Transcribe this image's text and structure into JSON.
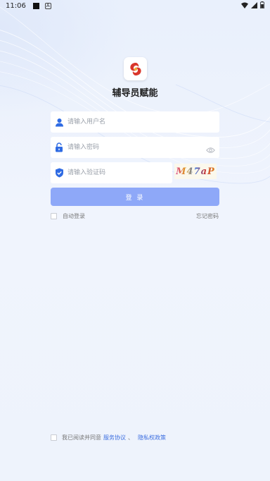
{
  "status_bar": {
    "time": "11:06",
    "notification_icon": "a-icon",
    "icons": [
      "wifi-icon",
      "signal-icon",
      "battery-icon"
    ]
  },
  "app": {
    "title": "辅导员赋能",
    "logo_icon": "red-emblem-logo"
  },
  "form": {
    "username_placeholder": "请输入用户名",
    "password_placeholder": "请输入密码",
    "captcha_placeholder": "请输入验证码",
    "captcha_text": "M47aP",
    "login_label": "登 录",
    "auto_login_label": "自动登录",
    "forgot_password_label": "忘记密码"
  },
  "agreement": {
    "prefix": "我已阅读并同意",
    "service_link": "服务协议",
    "separator": "、",
    "privacy_link": "隐私权政策"
  },
  "colors": {
    "accent": "#8ea8f8",
    "link": "#3d6fe0",
    "icon_blue": "#2f6be3",
    "logo_red": "#d9362b"
  }
}
